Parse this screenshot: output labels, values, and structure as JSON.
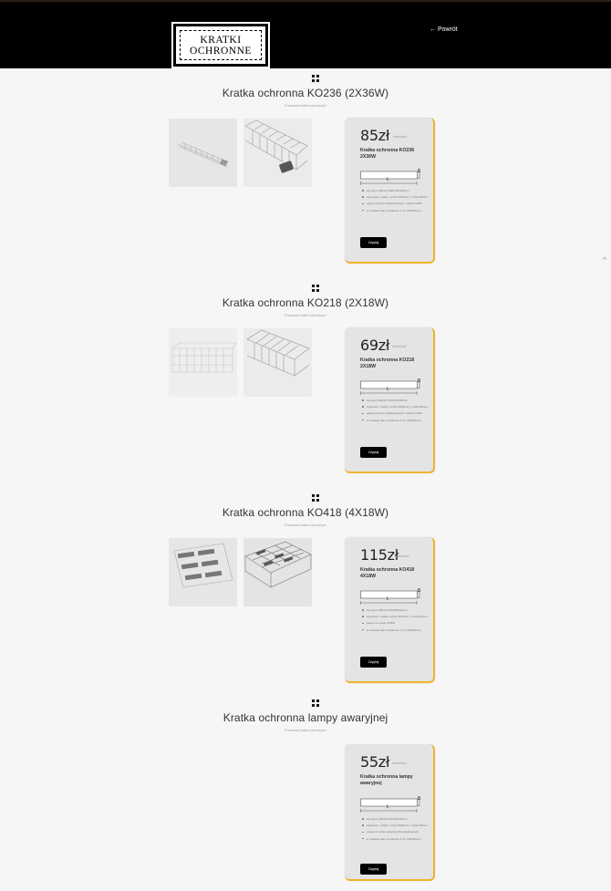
{
  "header": {
    "logo_line1": "KRATKI",
    "logo_line2": "OCHRONNE",
    "back_link": "← Powrót"
  },
  "scroll_up": "^",
  "products": [
    {
      "title": "Kratka ochronna KO236 (2X36W)",
      "subtitle": "Producent kratek ochronnych",
      "price": "85zł",
      "price_note": "netto/szt.",
      "card_name": "Kratka ochronna KO236 2X36W",
      "dim_b": "B",
      "dim_l": "L",
      "features": [
        "wymiary (LxBxH) 1300x155x100mm",
        "wykonane z siatki o oczku 50x50mm, z drutu Ø4mm",
        "pasuje do lamp świetlówkowych i opraw 2x36W",
        "w zestawie haki montażowe 4 szt. (Φ5x80mm)"
      ],
      "button": "Zapytaj"
    },
    {
      "title": "Kratka ochronna KO218 (2X18W)",
      "subtitle": "Producent kratek ochronnych",
      "price": "69zł",
      "price_note": "netto/szt.",
      "card_name": "Kratka ochronna KO218 2X18W",
      "dim_b": "B",
      "dim_l": "L",
      "features": [
        "wymiary (LxBxH) 700x155x100mm",
        "wykonane z siatki o oczku 50x50mm, z drutu Ø4mm",
        "pasuje do lamp świetlówkowych i opraw 2x18W",
        "w zestawie haki montażowe 4 szt. (Φ5x80mm)"
      ],
      "button": "Zapytaj"
    },
    {
      "title": "Kratka ochronna KO418 (4X18W)",
      "subtitle": "Producent kratek ochronnych",
      "price": "115zł",
      "price_note": "netto/szt.",
      "card_name": "Kratka ochronna KO418 4X18W",
      "dim_b": "B",
      "dim_l": "L",
      "features": [
        "wymiary (LxBxH) 630x630x100mm",
        "wykonane z siatki o oczku 50x50mm, z drutu Ø4mm",
        "pasuje do opraw 4x18W",
        "w zestawie haki montażowe 4 szt. (Φ5x80mm)"
      ],
      "button": "Zapytaj"
    },
    {
      "title": "Kratka ochronna lampy awaryjnej",
      "subtitle": "Producent kratek ochronnych",
      "price": "55zł",
      "price_note": "netto/szt.",
      "card_name": "Kratka ochronna lampy awaryjnej",
      "dim_b": "B",
      "dim_l": "L",
      "features": [
        "wymiary (LxBxH) 400x155x100mm",
        "wykonane z siatki o oczku 50x50mm, z drutu Ø4mm",
        "pasuje do opraw awaryjnych/ewakuacyjnych",
        "w zestawie haki montażowe 4 szt. (Φ5x80mm)"
      ],
      "button": "Zapytaj"
    }
  ]
}
